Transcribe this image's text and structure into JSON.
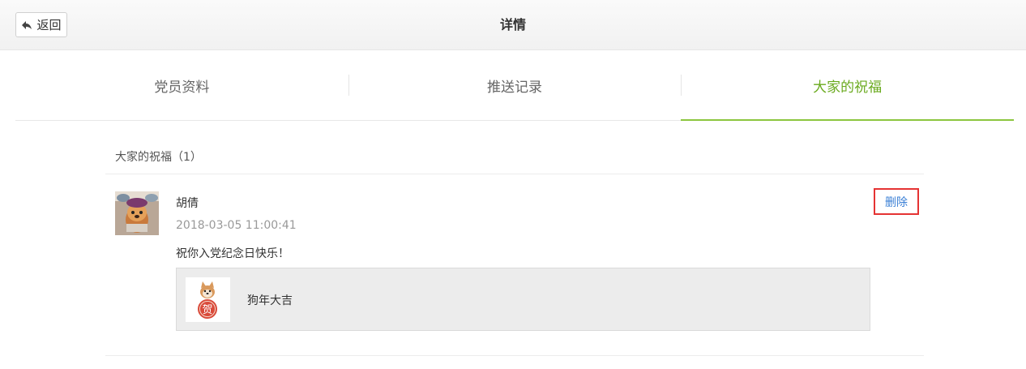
{
  "header": {
    "back_label": "返回",
    "title": "详情"
  },
  "tabs": [
    {
      "label": "党员资料",
      "active": false
    },
    {
      "label": "推送记录",
      "active": false
    },
    {
      "label": "大家的祝福",
      "active": true
    }
  ],
  "blessings": {
    "section_title": "大家的祝福（1）",
    "items": [
      {
        "user_name": "胡倩",
        "timestamp": "2018-03-05 11:00:41",
        "message": "祝你入党纪念日快乐！",
        "delete_label": "删除",
        "gift": {
          "name": "狗年大吉",
          "badge_char": "贺"
        }
      }
    ]
  },
  "colors": {
    "accent": "#6aaa1e",
    "tab_underline": "#8cc63f",
    "link": "#3a7fd5",
    "highlight_border": "#e53333"
  }
}
